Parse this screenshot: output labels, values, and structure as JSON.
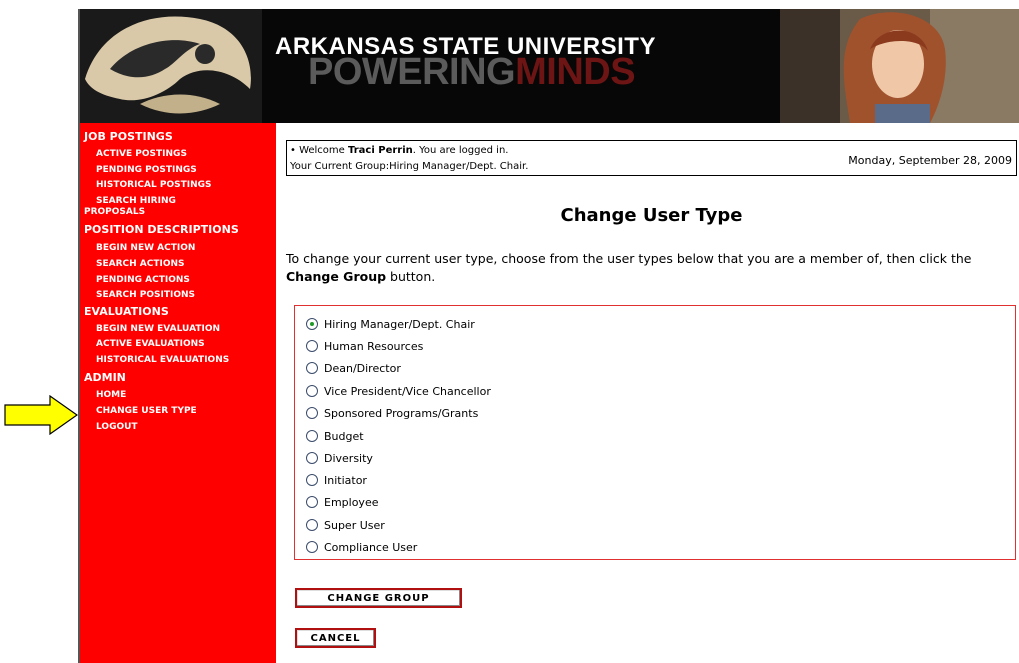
{
  "banner": {
    "title": "ARKANSAS STATE UNIVERSITY",
    "tagline_a": "POWERING",
    "tagline_b": "MINDS"
  },
  "sidebar": {
    "job_postings": {
      "heading": "JOB POSTINGS",
      "items": [
        "ACTIVE POSTINGS",
        "PENDING POSTINGS",
        "HISTORICAL POSTINGS",
        "SEARCH HIRING",
        "PROPOSALS"
      ]
    },
    "position_descriptions": {
      "heading": "POSITION DESCRIPTIONS",
      "items": [
        "BEGIN NEW ACTION",
        "SEARCH ACTIONS",
        "PENDING ACTIONS",
        "SEARCH POSITIONS"
      ]
    },
    "evaluations": {
      "heading": "EVALUATIONS",
      "items": [
        "BEGIN NEW EVALUATION",
        "ACTIVE EVALUATIONS",
        "HISTORICAL EVALUATIONS"
      ]
    },
    "admin": {
      "heading": "ADMIN",
      "items": [
        "HOME",
        "CHANGE USER TYPE",
        "LOGOUT"
      ]
    }
  },
  "welcome": {
    "prefix": "• Welcome ",
    "user": "Traci Perrin",
    "suffix": ". You are logged in.",
    "group_line": "Your Current Group:Hiring Manager/Dept. Chair.",
    "date": "Monday, September 28, 2009"
  },
  "page_title": "Change User Type",
  "instructions": {
    "text_before": "To change your current user type, choose from the user types below that you are a member of, then click the ",
    "bold": "Change Group",
    "text_after": " button."
  },
  "options": {
    "selected_index": 0,
    "items": [
      "Hiring Manager/Dept. Chair",
      "Human Resources",
      "Dean/Director",
      "Vice President/Vice Chancellor",
      "Sponsored Programs/Grants",
      "Budget",
      "Diversity",
      "Initiator",
      "Employee",
      "Super User",
      "Compliance User"
    ]
  },
  "buttons": {
    "change_group": "CHANGE GROUP",
    "cancel": "CANCEL"
  },
  "colors": {
    "sidebar": "#ff0000",
    "banner": "#070707",
    "arrow": "#ffff00"
  }
}
